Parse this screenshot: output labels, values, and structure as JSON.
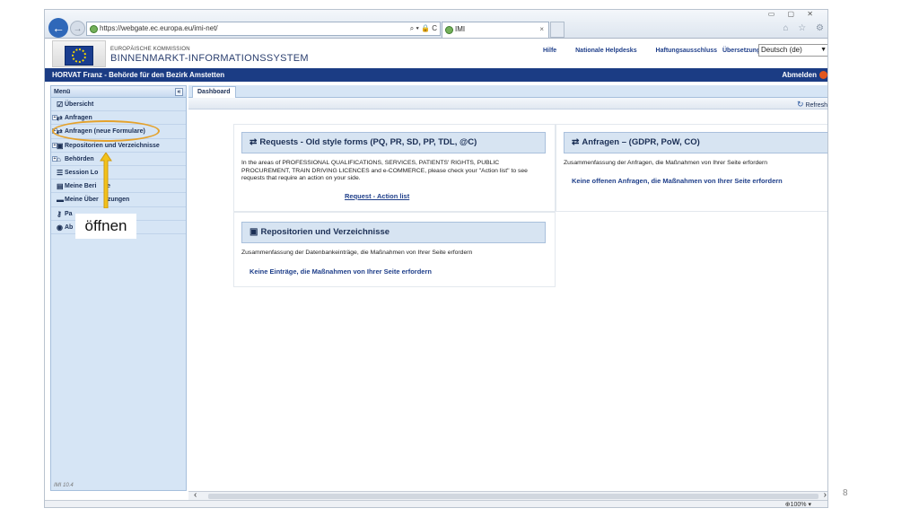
{
  "browser": {
    "url": "https://webgate.ec.europa.eu/imi-net/",
    "addr_controls": "⌕ ▾ 🔒 C",
    "tab_title": "IMI",
    "tab_close": "×",
    "window_controls": "▭ ▢ ✕",
    "toolbar_icons": "⌂ ☆ ⚙"
  },
  "site": {
    "commission": "EUROPÄISCHE KOMMISSION",
    "system_name": "BINNENMARKT-INFORMATIONSSYSTEM",
    "links": [
      "Hilfe",
      "Nationale Helpdesks",
      "Haftungsausschluss",
      "Übersetzung"
    ],
    "language": "Deutsch (de)",
    "user": "HORVAT Franz - Behörde für den Bezirk Amstetten",
    "logout": "Abmelden"
  },
  "sidebar": {
    "title": "Menü",
    "collapse": "«",
    "items": [
      {
        "label": "Übersicht",
        "expand": "",
        "icon": "overview-icon",
        "glyph": "☑"
      },
      {
        "label": "Anfragen",
        "expand": "+",
        "icon": "exchange-icon",
        "glyph": "⇄"
      },
      {
        "label": "Anfragen (neue Formulare)",
        "expand": "+",
        "icon": "exchange-icon",
        "glyph": "⇄"
      },
      {
        "label": "Repositorien und Verzeichnisse",
        "expand": "+",
        "icon": "briefcase-icon",
        "glyph": "▣"
      },
      {
        "label": "Behörden",
        "expand": "+",
        "icon": "building-icon",
        "glyph": "⌂"
      },
      {
        "label": "Session Lo",
        "expand": "",
        "icon": "list-icon",
        "glyph": "☰"
      },
      {
        "label": "Meine Beri      e",
        "expand": "",
        "icon": "report-icon",
        "glyph": "▤"
      },
      {
        "label": "Meine Über    tzungen",
        "expand": "",
        "icon": "chat-icon",
        "glyph": "▬"
      },
      {
        "label": "Pa",
        "expand": "",
        "icon": "key-icon",
        "glyph": "⚷"
      },
      {
        "label": "Ab",
        "expand": "",
        "icon": "info-icon",
        "glyph": "◉"
      }
    ],
    "version": "IMI 10.4"
  },
  "callout": {
    "label": "öffnen",
    "color": "#e4a22c"
  },
  "content": {
    "tab": "Dashboard",
    "refresh": "Refresh",
    "panel1": {
      "title": "Requests - Old style forms (PQ, PR, SD, PP, TDL, @C)",
      "text": "In the areas of PROFESSIONAL QUALIFICATIONS, SERVICES, PATIENTS' RIGHTS, PUBLIC PROCUREMENT, TRAIN DRIVING LICENCES and e-COMMERCE, please check your \"Action list\" to see requests that require an action on your side.",
      "link": "Request - Action list"
    },
    "panel2": {
      "title": "Anfragen – (GDPR, PoW, CO)",
      "text": "Zusammenfassung der Anfragen, die Maßnahmen von Ihrer Seite erfordern",
      "link": "Keine offenen Anfragen, die Maßnahmen von Ihrer Seite erfordern"
    },
    "panel3": {
      "title": "Repositorien und Verzeichnisse",
      "text": "Zusammenfassung der Datenbankeinträge, die Maßnahmen von Ihrer Seite erfordern",
      "link": "Keine Einträge, die Maßnahmen von Ihrer Seite erfordern"
    }
  },
  "status": {
    "zoom": "100%"
  },
  "slide_number": "8"
}
